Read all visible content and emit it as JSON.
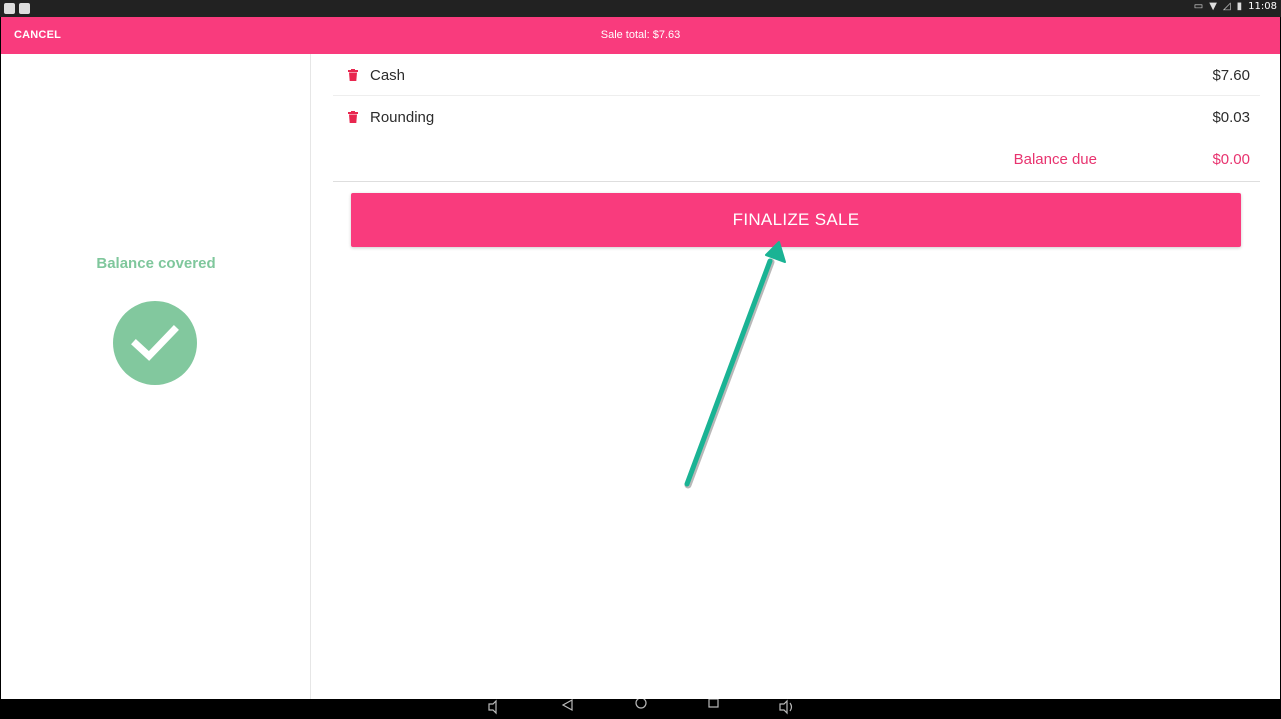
{
  "status_bar": {
    "time": "11:08",
    "left_icons": [
      "app-notification-icon",
      "mail-icon"
    ],
    "right_icons": [
      "cast-icon",
      "wifi-icon",
      "signal-icon",
      "battery-icon"
    ]
  },
  "app_bar": {
    "cancel_label": "CANCEL",
    "sale_total": "Sale total: $7.63",
    "color": "#f93b7d"
  },
  "left_panel": {
    "status_text": "Balance covered",
    "status_color": "#7fc79c",
    "icon": "check-circle-icon"
  },
  "payments": [
    {
      "label": "Cash",
      "amount": "$7.60",
      "icon": "trash-icon"
    },
    {
      "label": "Rounding",
      "amount": "$0.03",
      "icon": "trash-icon"
    }
  ],
  "balance": {
    "label": "Balance due",
    "amount": "$0.00",
    "color": "#e8336f"
  },
  "finalize_button": {
    "label": "FINALIZE SALE"
  },
  "annotation": {
    "color": "#1ab394",
    "icon": "pointer-arrow"
  },
  "nav_bar": {
    "icons": [
      "volume-down-icon",
      "back-icon",
      "home-icon",
      "recents-icon",
      "volume-up-icon"
    ]
  }
}
